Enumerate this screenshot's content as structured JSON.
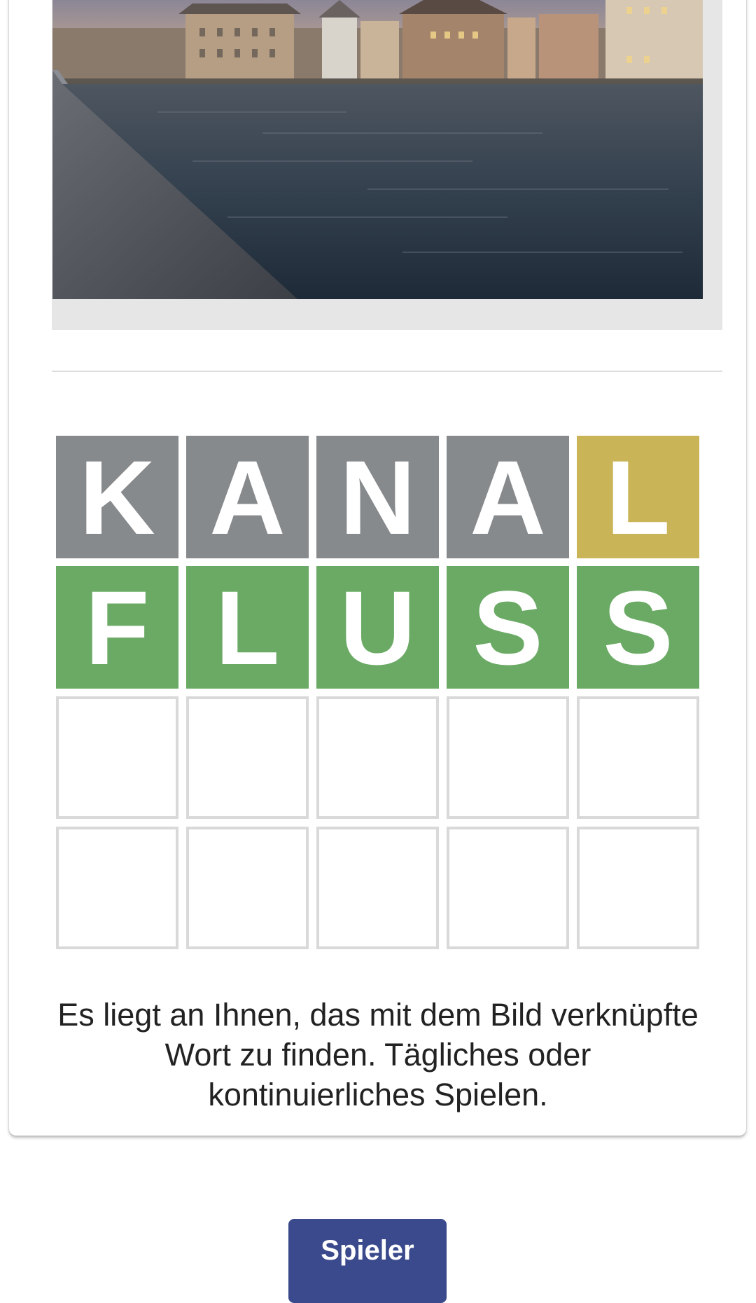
{
  "image": {
    "alt": ""
  },
  "colors": {
    "absent": "#878a8c",
    "present": "#c9b458",
    "correct": "#6aaa64",
    "empty_border": "#d9d9d9",
    "button": "#3a4a8c"
  },
  "board": {
    "rows": [
      [
        {
          "letter": "K",
          "state": "absent"
        },
        {
          "letter": "A",
          "state": "absent"
        },
        {
          "letter": "N",
          "state": "absent"
        },
        {
          "letter": "A",
          "state": "absent"
        },
        {
          "letter": "L",
          "state": "present"
        }
      ],
      [
        {
          "letter": "F",
          "state": "correct"
        },
        {
          "letter": "L",
          "state": "correct"
        },
        {
          "letter": "U",
          "state": "correct"
        },
        {
          "letter": "S",
          "state": "correct"
        },
        {
          "letter": "S",
          "state": "correct"
        }
      ],
      [
        {
          "letter": "",
          "state": "empty"
        },
        {
          "letter": "",
          "state": "empty"
        },
        {
          "letter": "",
          "state": "empty"
        },
        {
          "letter": "",
          "state": "empty"
        },
        {
          "letter": "",
          "state": "empty"
        }
      ],
      [
        {
          "letter": "",
          "state": "empty"
        },
        {
          "letter": "",
          "state": "empty"
        },
        {
          "letter": "",
          "state": "empty"
        },
        {
          "letter": "",
          "state": "empty"
        },
        {
          "letter": "",
          "state": "empty"
        }
      ]
    ]
  },
  "description": "Es liegt an Ihnen, das mit dem Bild verknüpfte Wort zu finden. Tägliches oder kontinuierliches Spielen.",
  "play_button": {
    "label": "Spieler"
  }
}
